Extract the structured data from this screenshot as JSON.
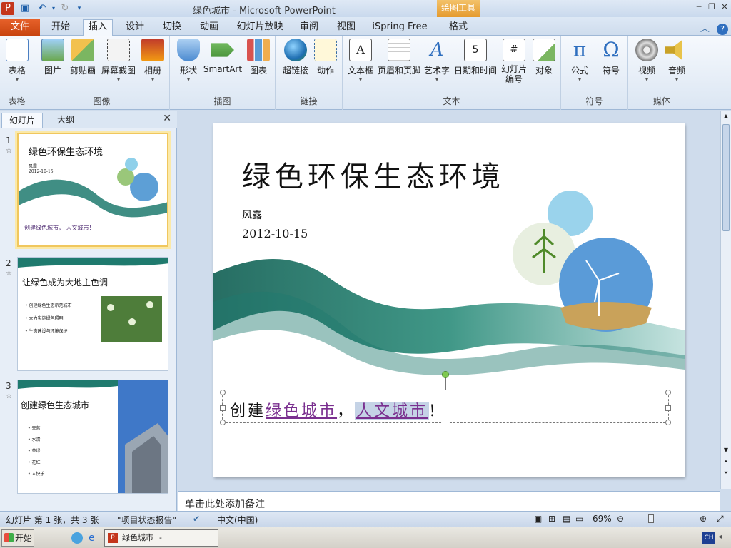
{
  "window": {
    "title": "绿色城市 - Microsoft PowerPoint",
    "contextual_tab": "绘图工具"
  },
  "tabs": {
    "file": "文件",
    "items": [
      "开始",
      "插入",
      "设计",
      "切换",
      "动画",
      "幻灯片放映",
      "审阅",
      "视图",
      "iSpring Free",
      "格式"
    ],
    "active": "插入"
  },
  "ribbon": {
    "groups": [
      {
        "label": "表格",
        "buttons": [
          "表格"
        ]
      },
      {
        "label": "图像",
        "buttons": [
          "图片",
          "剪贴画",
          "屏幕截图",
          "相册"
        ]
      },
      {
        "label": "插图",
        "buttons": [
          "形状",
          "SmartArt",
          "图表"
        ]
      },
      {
        "label": "链接",
        "buttons": [
          "超链接",
          "动作"
        ]
      },
      {
        "label": "文本",
        "buttons": [
          "文本框",
          "页眉和页脚",
          "艺术字",
          "日期和时间",
          "幻灯片编号",
          "对象"
        ]
      },
      {
        "label": "符号",
        "buttons": [
          "公式",
          "符号"
        ]
      },
      {
        "label": "媒体",
        "buttons": [
          "视频",
          "音频"
        ]
      }
    ]
  },
  "left_pane": {
    "tabs": [
      "幻灯片",
      "大纲"
    ],
    "thumbnails": [
      {
        "num": "1",
        "title": "绿色环保生态环境",
        "line1": "风露",
        "line2": "2012-10-15",
        "footer": "创建绿色城市， 人文城市！"
      },
      {
        "num": "2",
        "title": "让绿色成为大地主色调",
        "bullets": [
          "创建绿色生态示范城市",
          "大力实施绿色照明",
          "生态建设与环境保护"
        ]
      },
      {
        "num": "3",
        "title": "创建绿色生态城市",
        "bullets": [
          "天蓝",
          "水清",
          "草绿",
          "花红",
          "人快乐"
        ]
      }
    ]
  },
  "slide": {
    "title": "绿色环保生态环境",
    "author": "风露",
    "date": "2012-10-15",
    "caption_pre": "创建",
    "caption_link1": "绿色城市",
    "caption_comma": "，",
    "caption_link2": "人文城市",
    "caption_end": "!"
  },
  "notes": {
    "placeholder": "单击此处添加备注"
  },
  "status": {
    "slide_info": "幻灯片 第 1 张，共 3 张",
    "theme": "\"项目状态报告\"",
    "language": "中文(中国)",
    "zoom": "69%"
  },
  "taskbar": {
    "start": "开始",
    "item": "绿色城市 - Microsof...",
    "ime": "CH"
  },
  "colors": {
    "accent": "#c8440f",
    "link": "#7a2f8f",
    "wave": "#1f7a6e"
  }
}
